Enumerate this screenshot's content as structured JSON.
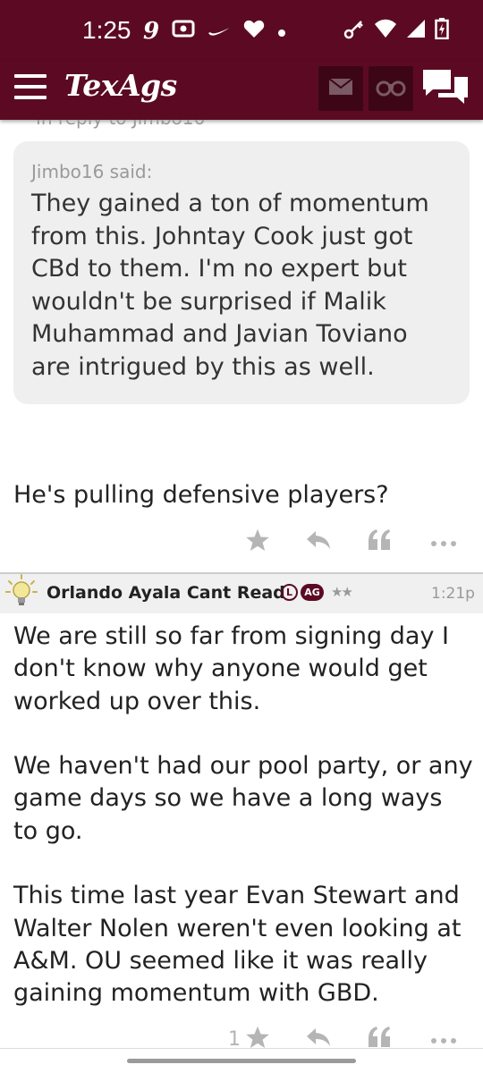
{
  "status_bar": {
    "time": "1:25",
    "notification_icons": [
      "9-app-icon",
      "radio-icon",
      "nike-swoosh-icon",
      "heart-icon",
      "dot-icon"
    ],
    "system_icons": [
      "key-icon",
      "wifi-icon",
      "signal-icon",
      "battery-charging-icon"
    ]
  },
  "app_bar": {
    "logo": "TexAgs",
    "buttons": [
      "mail-icon",
      "binoculars-icon",
      "chat-bubbles-icon"
    ]
  },
  "colors": {
    "brand_maroon": "#5c0a24",
    "quote_bg": "#efefef",
    "post_header_bg": "#f0f0f0",
    "muted_text": "#999999",
    "action_gray": "#b5b5b5"
  },
  "thread": {
    "quote": {
      "author_line": "Jimbo16 said:",
      "text": "They gained a ton of momentum from this. Johntay Cook just got CBd to them. I'm no expert but wouldn't be surprised if Malik Muhammad and Javian Toviano are intrigued by this as well."
    },
    "first_post_reply": "He's pulling defensive players?",
    "second_post": {
      "author": "Orlando Ayala Cant Read",
      "badge_l": "L",
      "badge_ag": "AG",
      "stars": "★★",
      "time": "1:21p",
      "paragraphs": [
        "We are still so far from signing day I don't know why anyone would get worked up over this.",
        "We haven't had our pool party, or any game days so we have a long ways to go.",
        "This time last year Evan Stewart and Walter Nolen weren't even looking at A&M. OU seemed like it was really gaining momentum with GBD."
      ],
      "star_count": "1"
    }
  }
}
